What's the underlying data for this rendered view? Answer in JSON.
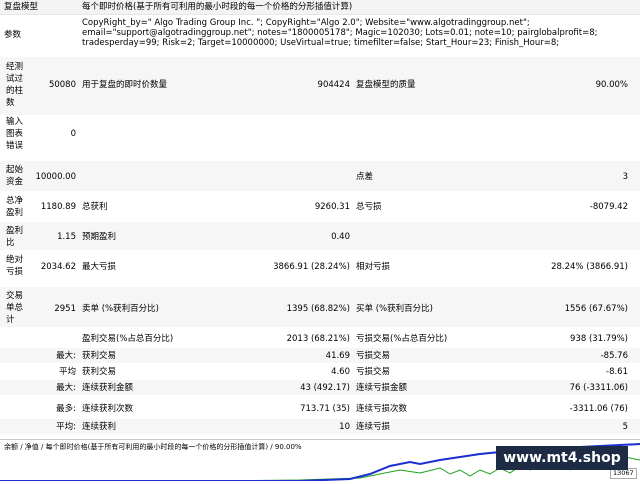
{
  "report": {
    "model_label": "复盘模型",
    "model_value": "每个即时价格(基于所有可利用的最小时段的每一个价格的分形插值计算)",
    "params_label": "参数",
    "params_lines": [
      "CopyRight_by=\" Algo Trading Group Inc. \"; CopyRight=\"Algo 2.0\"; Website=\"www.algotradinggroup.net\";",
      "email=\"support@algotradinggroup.net\"; notes=\"1800005178\"; Magic=102030; Lots=0.01; note=10; pairglobalprofit=8;",
      "tradesperday=99; Risk=2; Target=10000000; UseVirtual=true; timefilter=false; Start_Hour=23; Finish_Hour=8;"
    ],
    "bars_label_lines": [
      "经测",
      "试过",
      "的柱",
      "数"
    ],
    "bars_value": "50080",
    "ticks_label": "用于复盘的即时价数量",
    "ticks_value": "904424",
    "quality_label": "复盘模型的质量",
    "quality_value": "90.00%",
    "errors_label_lines": [
      "输入",
      "图表",
      "错误"
    ],
    "errors_value": "0",
    "deposit_label_lines": [
      "起始",
      "资金"
    ],
    "deposit_value": "10000.00",
    "spread_label": "点差",
    "spread_value": "3",
    "net_label_lines": [
      "总净",
      "盈利"
    ],
    "net_value": "1180.89",
    "gross_profit_label": "总获利",
    "gross_profit_value": "9260.31",
    "gross_loss_label": "总亏损",
    "gross_loss_value": "-8079.42",
    "pf_label_lines": [
      "盈利",
      "比"
    ],
    "pf_value": "1.15",
    "expected_label": "预期盈利",
    "expected_value": "0.40",
    "abs_dd_label_lines": [
      "绝对",
      "亏损"
    ],
    "abs_dd_value": "2034.62",
    "max_dd_label": "最大亏损",
    "max_dd_value": "3866.91 (28.24%)",
    "rel_dd_label": "相对亏损",
    "rel_dd_value": "28.24% (3866.91)",
    "trades_label_lines": [
      "交易",
      "单总",
      "计"
    ],
    "trades_value": "2951",
    "short_label": "卖单 (%获利百分比)",
    "short_value": "1395 (68.82%)",
    "long_label": "买单 (%获利百分比)",
    "long_value": "1556 (67.67%)",
    "win_trades_label": "盈利交易(%占总百分比)",
    "win_trades_value": "2013 (68.21%)",
    "loss_trades_label": "亏损交易(%占总百分比)",
    "loss_trades_value": "938 (31.79%)",
    "rows": [
      {
        "prefix": "最大:",
        "l1": "获利交易",
        "v1": "41.69",
        "l2": "亏损交易",
        "v2": "-85.76"
      },
      {
        "prefix": "平均",
        "l1": "获利交易",
        "v1": "4.60",
        "l2": "亏损交易",
        "v2": "-8.61"
      },
      {
        "prefix": "最大:",
        "l1": "连续获利金额",
        "v1": "43 (492.17)",
        "l2": "连续亏损金额",
        "v2": "76 (-3311.06)"
      },
      {
        "prefix": "最多:",
        "l1": "连续获利次数",
        "v1": "713.71 (35)",
        "l2": "连续亏损次数",
        "v2": "-3311.06 (76)"
      },
      {
        "prefix": "平均:",
        "l1": "连续获利",
        "v1": "10",
        "l2": "连续亏损",
        "v2": "5"
      }
    ]
  },
  "chart": {
    "header_text": "余额 / 净值 / 每个即时价格(基于所有可利用的最小时段的每一个价格的分形插值计算) / 90.00%",
    "axis_value": "13067",
    "balance_color": "#1a2fd0",
    "equity_color": "#1aa01a"
  },
  "watermark": "www.mt4.shop"
}
